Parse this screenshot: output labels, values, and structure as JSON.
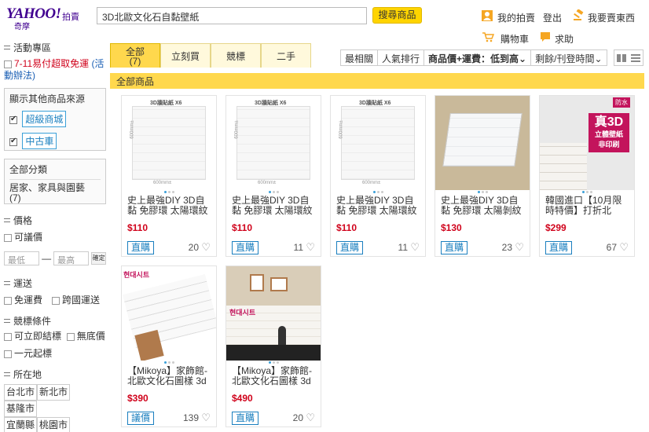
{
  "header": {
    "logo_text": "YAHOO!",
    "logo_sub": "奇摩",
    "logo_auction": "拍賣",
    "search_value": "3D北歐文化石自黏壁紙",
    "search_button": "搜尋商品",
    "links": {
      "my_auction": "我的拍賣",
      "logout": "登出",
      "sell": "我要賣東西",
      "cart": "購物車",
      "help": "求助"
    }
  },
  "sidebar": {
    "events_title": "活動專區",
    "event_link_red": "7-11易付超取免運",
    "event_link_blue": "(活動辦法)",
    "source_title": "顯示其他商品來源",
    "sources": [
      "超級商城",
      "中古車"
    ],
    "categories_title": "全部分類",
    "category_item": "居家、家具與園藝",
    "category_count": "(7)",
    "price_title": "價格",
    "price_option": "可議價",
    "price_min_placeholder": "最低",
    "price_max_placeholder": "最高",
    "price_dash": "—",
    "price_ok": "確定",
    "shipping_title": "運送",
    "shipping_options": [
      "免運費",
      "跨國運送"
    ],
    "bid_title": "競標條件",
    "bid_options": [
      "可立即結標",
      "無底價",
      "一元起標"
    ],
    "location_title": "所在地",
    "locations": [
      "台北市",
      "新北市",
      "基隆市",
      "宜蘭縣",
      "桃園市"
    ]
  },
  "tabs": [
    {
      "label": "全部",
      "count": "(7)"
    },
    {
      "label": "立刻買"
    },
    {
      "label": "競標"
    },
    {
      "label": "二手"
    }
  ],
  "sort": [
    "最相關",
    "人氣排行",
    "商品價+運費：低到高",
    "剩餘/刊登時間"
  ],
  "category_bar": "全部商品",
  "products": [
    {
      "title": "史上最強DIY 3D自黏 免膠環 太陽環紋",
      "price": "$110",
      "badge": "直購",
      "likes": "20"
    },
    {
      "title": "史上最強DIY 3D自黏 免膠環 太陽環紋",
      "price": "$110",
      "badge": "直購",
      "likes": "11"
    },
    {
      "title": "史上最強DIY 3D自黏 免膠環 太陽環紋",
      "price": "$110",
      "badge": "直購",
      "likes": "11"
    },
    {
      "title": "史上最強DIY 3D自黏 免膠環 太陽剝紋",
      "price": "$130",
      "badge": "直購",
      "likes": "23"
    },
    {
      "title": "韓國進口【10月限時特價】打折北",
      "price": "$299",
      "badge": "直購",
      "likes": "67"
    },
    {
      "title": "【Mikoya】家飾館-北歐文化石圖樣 3d",
      "price": "$390",
      "badge": "議價",
      "likes": "139"
    },
    {
      "title": "【Mikoya】家飾館-北歐文化石圖樣 3d",
      "price": "$490",
      "badge": "直購",
      "likes": "20"
    }
  ],
  "product_image_text": {
    "brand_label": "3D牆貼紙 X6",
    "width_dim": "600mm±",
    "height_dim": "600mm±",
    "korean_text": "현대시트",
    "promo_tag": "防水",
    "promo_main": "真3D",
    "promo_sub": "立體壁紙",
    "promo_sub2": "非印刷"
  },
  "colors": {
    "accent_yellow": "#ffd84d",
    "brand_purple": "#400090",
    "price_red": "#d0021b",
    "link_blue": "#1a7fbf"
  }
}
